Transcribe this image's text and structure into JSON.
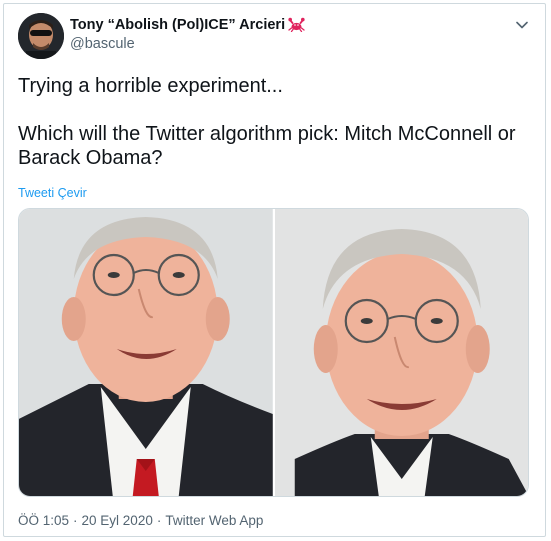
{
  "author": {
    "name": "Tony “Abolish (Pol)ICE” Arcieri",
    "handle": "@bascule"
  },
  "tweet": {
    "text": "Trying a horrible experiment...\n\nWhich will the Twitter algorithm pick: Mitch McConnell or Barack Obama?",
    "translate_label": "Tweeti Çevir"
  },
  "meta": {
    "time": "ÖÖ 1:05",
    "date": "20 Eyl 2020",
    "separator": "·",
    "source": "Twitter Web App"
  },
  "colors": {
    "link": "#1d9bf0",
    "secondary_text": "#536471",
    "border": "#cfd9de",
    "crab_emoji": "#e0245e"
  },
  "icons": {
    "name_emoji": "crab-icon",
    "menu": "chevron-down-icon"
  }
}
